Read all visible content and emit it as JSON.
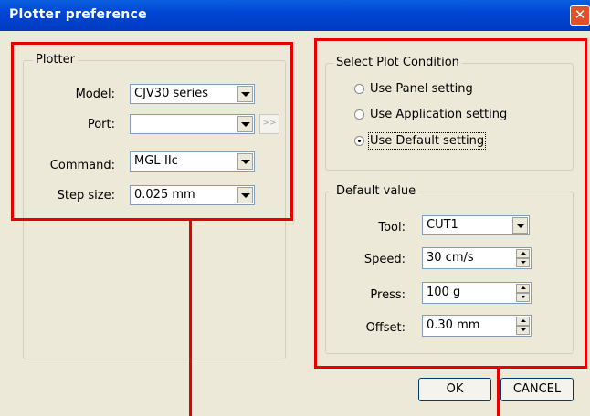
{
  "window": {
    "title": "Plotter preference",
    "close_glyph": "✕"
  },
  "plotter": {
    "legend": "Plotter",
    "model": {
      "label": "Model:",
      "value": "CJV30 series"
    },
    "port": {
      "label": "Port:",
      "value": "",
      "extra_button": ">>"
    },
    "command": {
      "label": "Command:",
      "value": "MGL-IIc"
    },
    "step": {
      "label": "Step size:",
      "value": "0.025 mm"
    }
  },
  "plot_condition": {
    "legend": "Select Plot Condition",
    "options": [
      {
        "label": "Use Panel setting",
        "selected": false
      },
      {
        "label": "Use Application setting",
        "selected": false
      },
      {
        "label": "Use Default setting",
        "selected": true
      }
    ]
  },
  "default_value": {
    "legend": "Default value",
    "tool": {
      "label": "Tool:",
      "value": "CUT1"
    },
    "speed": {
      "label": "Speed:",
      "value": "30 cm/s"
    },
    "press": {
      "label": "Press:",
      "value": "100 g"
    },
    "offset": {
      "label": "Offset:",
      "value": "0.30 mm"
    }
  },
  "buttons": {
    "ok": "OK",
    "cancel": "CANCEL"
  },
  "colors": {
    "titlebar": "#0046d5",
    "annotation": "#e60000",
    "dialog_bg": "#ece9d8"
  }
}
